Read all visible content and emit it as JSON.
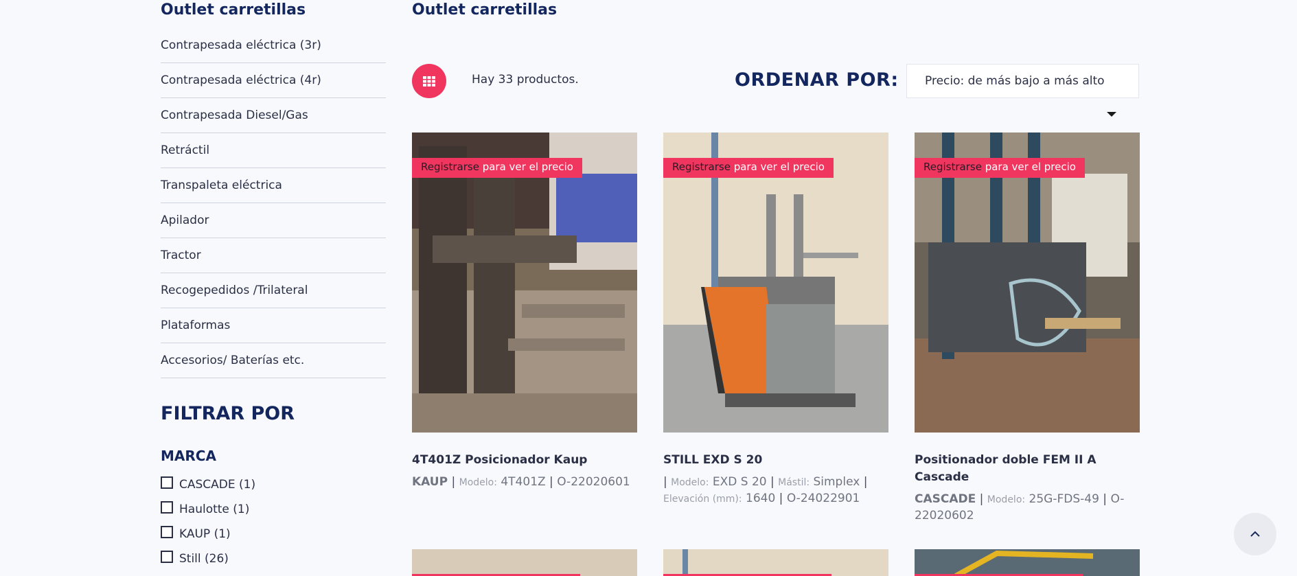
{
  "sidebar": {
    "title": "Outlet carretillas",
    "categories": [
      "Contrapesada eléctrica (3r)",
      "Contrapesada eléctrica (4r)",
      "Contrapesada Diesel/Gas",
      "Retráctil",
      "Transpaleta eléctrica",
      "Apilador",
      "Tractor",
      "Recogepedidos /Trilateral",
      "Plataformas",
      "Accesorios/ Baterías etc."
    ],
    "filter_title": "FILTRAR POR",
    "brand_title": "MARCA",
    "brands": [
      "CASCADE (1)",
      "Haulotte (1)",
      "KAUP (1)",
      "Still (26)"
    ]
  },
  "main": {
    "title": "Outlet carretillas",
    "count": "Hay 33 productos.",
    "sort_label": "ORDENAR POR:",
    "sort_value": "Precio: de más bajo a más alto"
  },
  "badge": {
    "register": "Registrarse",
    "rest": " para ver el precio"
  },
  "products": [
    {
      "name": "4T401Z Posicionador Kaup",
      "brand": "KAUP",
      "model_label": "Modelo:",
      "model": "4T401Z",
      "ref": "O-22020601"
    },
    {
      "name": "STILL EXD S 20",
      "model_label": "Modelo:",
      "model": "EXD S 20",
      "mast_label": "Mástil:",
      "mast": "Simplex",
      "elev_label": "Elevación (mm):",
      "elev": "1640",
      "ref": "O-24022901"
    },
    {
      "name": "Positionador doble FEM II A Cascade",
      "brand": "CASCADE",
      "model_label": "Modelo:",
      "model": "25G-FDS-49",
      "ref": "O-22020602"
    }
  ],
  "colors": {
    "accent": "#f0365f",
    "navy": "#13275e"
  },
  "icons": {
    "grid": "grid-icon",
    "back_to_top": "chevron-up-icon",
    "dropdown": "caret-down-icon"
  }
}
